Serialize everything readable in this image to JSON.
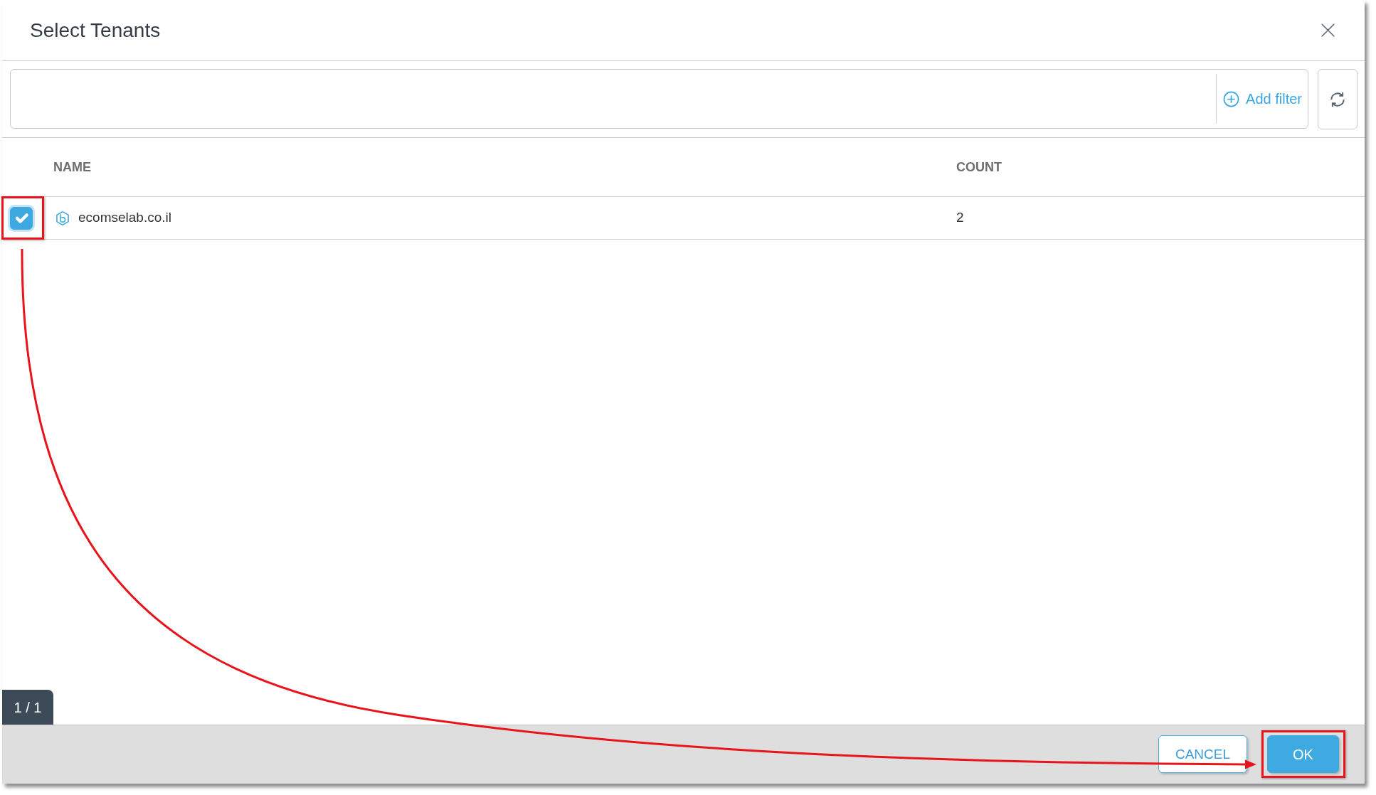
{
  "dialog": {
    "title": "Select Tenants"
  },
  "filter_bar": {
    "add_filter": "Add filter"
  },
  "table": {
    "columns": [
      "NAME",
      "COUNT"
    ],
    "rows": [
      {
        "checked": true,
        "highlighted": true,
        "name": "ecomselab.co.il",
        "count": "2"
      }
    ]
  },
  "page_indicator": "1 / 1",
  "footer_buttons": [
    {
      "kind": "secondary",
      "label": "CANCEL",
      "highlighted": false
    },
    {
      "kind": "primary",
      "label": "OK",
      "highlighted": true
    }
  ],
  "callout_arrow": true
}
